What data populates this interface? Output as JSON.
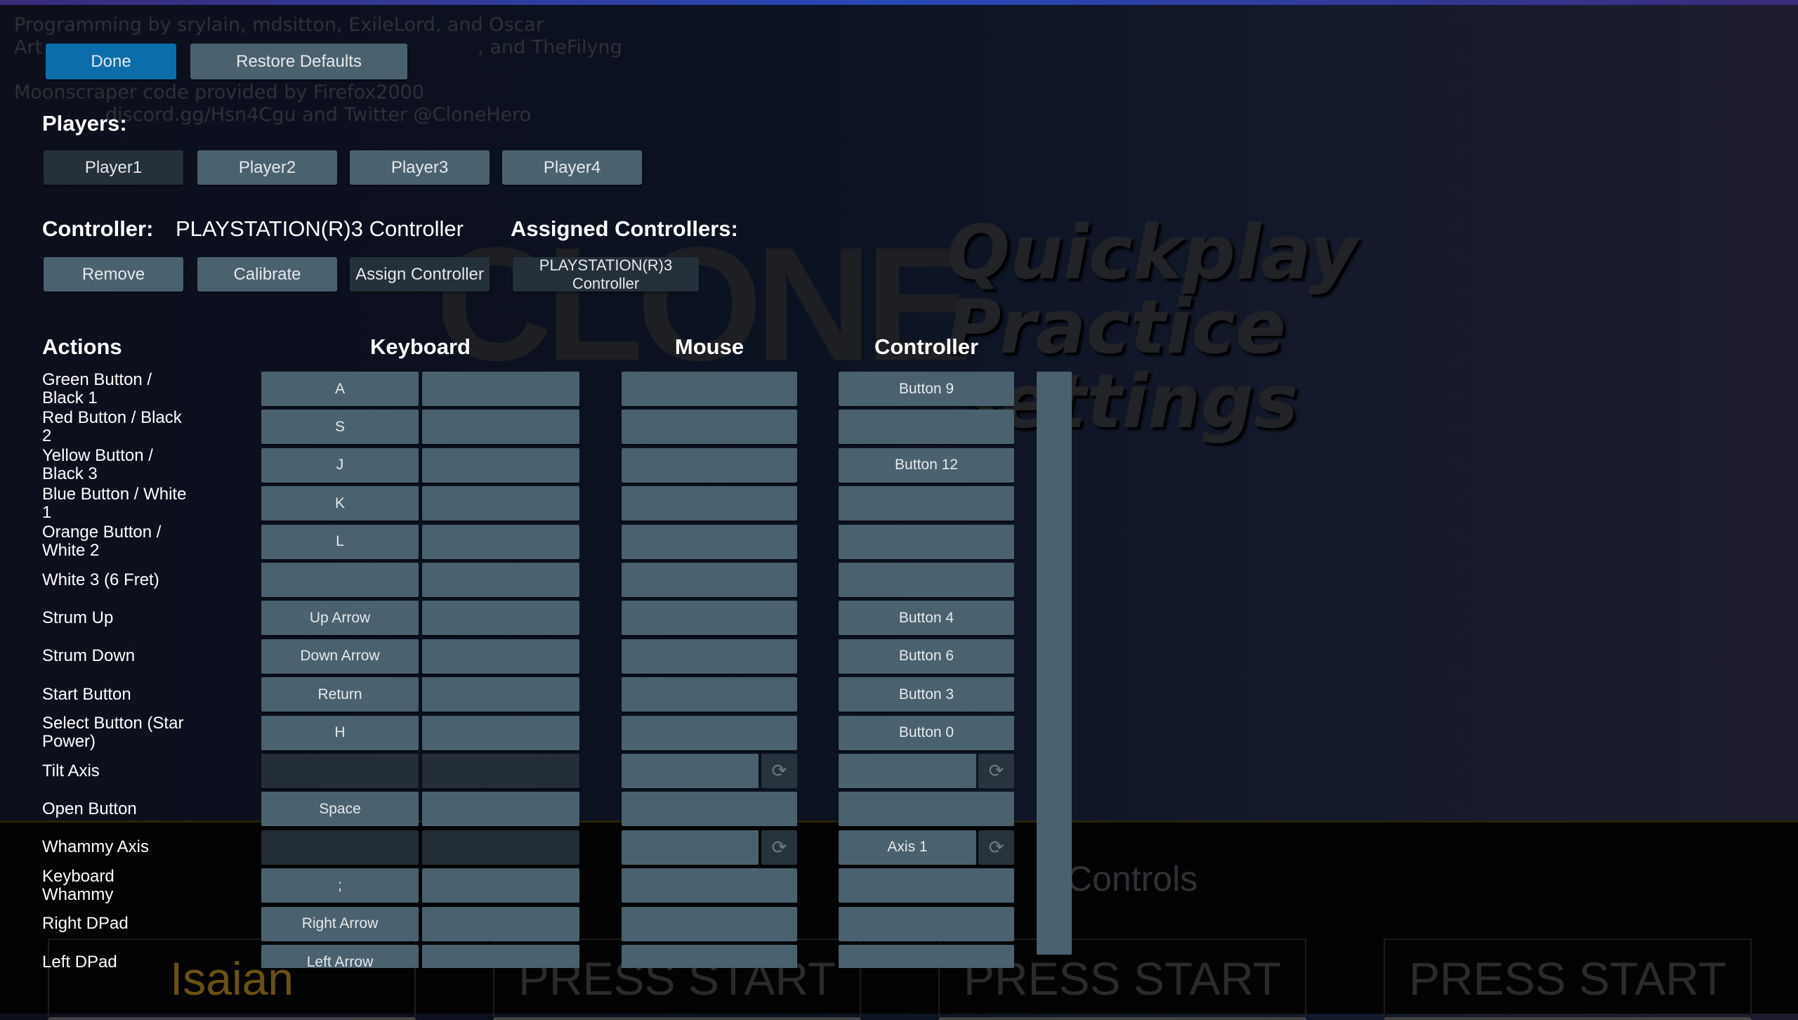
{
  "background": {
    "credits": [
      "Programming by srylain, mdsitton, ExileLord, and Oscar",
      "Art",
      ", and TheFilyng",
      "Moonscraper code provided by Firefox2000",
      "discord.gg/Hsn4Cgu and Twitter @CloneHero"
    ],
    "menu": [
      "Quickplay",
      "Practice",
      "Settings"
    ],
    "controls": "Controls",
    "player_slots": [
      "Isaian",
      "PRESS START",
      "PRESS START",
      "PRESS START"
    ],
    "player_slot_colors": [
      "#6b5210",
      "#2b2b2b",
      "#2b2b2b",
      "#2b2b2b"
    ]
  },
  "toolbar": {
    "done": "Done",
    "restore_defaults": "Restore Defaults"
  },
  "players": {
    "label": "Players:",
    "items": [
      "Player1",
      "Player2",
      "Player3",
      "Player4"
    ],
    "selected": 0
  },
  "controller": {
    "label": "Controller:",
    "name": "PLAYSTATION(R)3 Controller",
    "assigned_label": "Assigned Controllers:",
    "remove": "Remove",
    "calibrate": "Calibrate",
    "assign": "Assign Controller",
    "assigned": [
      "PLAYSTATION(R)3 Controller"
    ]
  },
  "bindings": {
    "headers": {
      "actions": "Actions",
      "keyboard": "Keyboard",
      "mouse": "Mouse",
      "controller": "Controller"
    },
    "reset_icon": "refresh-icon",
    "rows": [
      {
        "action": "Green Button / Black 1",
        "kb1": "A",
        "kb2": "",
        "mouse": "",
        "ctrl": "Button 9"
      },
      {
        "action": "Red Button / Black 2",
        "kb1": "S",
        "kb2": "",
        "mouse": "",
        "ctrl": ""
      },
      {
        "action": "Yellow Button / Black 3",
        "kb1": "J",
        "kb2": "",
        "mouse": "",
        "ctrl": "Button 12"
      },
      {
        "action": "Blue Button / White 1",
        "kb1": "K",
        "kb2": "",
        "mouse": "",
        "ctrl": ""
      },
      {
        "action": "Orange Button / White 2",
        "kb1": "L",
        "kb2": "",
        "mouse": "",
        "ctrl": ""
      },
      {
        "action": "White 3 (6 Fret)",
        "kb1": "",
        "kb2": "",
        "mouse": "",
        "ctrl": ""
      },
      {
        "action": "Strum Up",
        "kb1": "Up Arrow",
        "kb2": "",
        "mouse": "",
        "ctrl": "Button 4"
      },
      {
        "action": "Strum Down",
        "kb1": "Down Arrow",
        "kb2": "",
        "mouse": "",
        "ctrl": "Button 6"
      },
      {
        "action": "Start Button",
        "kb1": "Return",
        "kb2": "",
        "mouse": "",
        "ctrl": "Button 3"
      },
      {
        "action": "Select Button (Star Power)",
        "kb1": "H",
        "kb2": "",
        "mouse": "",
        "ctrl": "Button 0"
      },
      {
        "action": "Tilt Axis",
        "kb1": "",
        "kb2": "",
        "mouse": "",
        "ctrl": "",
        "axis": true
      },
      {
        "action": "Open Button",
        "kb1": "Space",
        "kb2": "",
        "mouse": "",
        "ctrl": ""
      },
      {
        "action": "Whammy Axis",
        "kb1": "",
        "kb2": "",
        "mouse": "",
        "ctrl": "Axis 1",
        "axis": true
      },
      {
        "action": "Keyboard Whammy",
        "kb1": ";",
        "kb2": "",
        "mouse": "",
        "ctrl": ""
      },
      {
        "action": "Right DPad",
        "kb1": "Right Arrow",
        "kb2": "",
        "mouse": "",
        "ctrl": ""
      },
      {
        "action": "Left DPad",
        "kb1": "Left Arrow",
        "kb2": "",
        "mouse": "",
        "ctrl": ""
      }
    ]
  }
}
